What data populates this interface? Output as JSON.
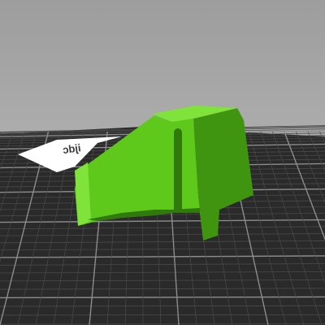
{
  "viewport": {
    "background_top": "#9d9d9d",
    "background_bottom": "#c2c2c2"
  },
  "bed": {
    "surface_color": "#2a2a2a",
    "grid_minor_color": "#4a4a4a",
    "grid_major_color": "#8c8c8c",
    "logo_text": "ijdc",
    "logo_color": "#ffffff",
    "logo_text_color": "#3a3a3a"
  },
  "model": {
    "color": "#5ec91a",
    "color_light": "#7fe33a",
    "color_dark": "#3f9410",
    "color_shadow": "#2f7a0a"
  }
}
